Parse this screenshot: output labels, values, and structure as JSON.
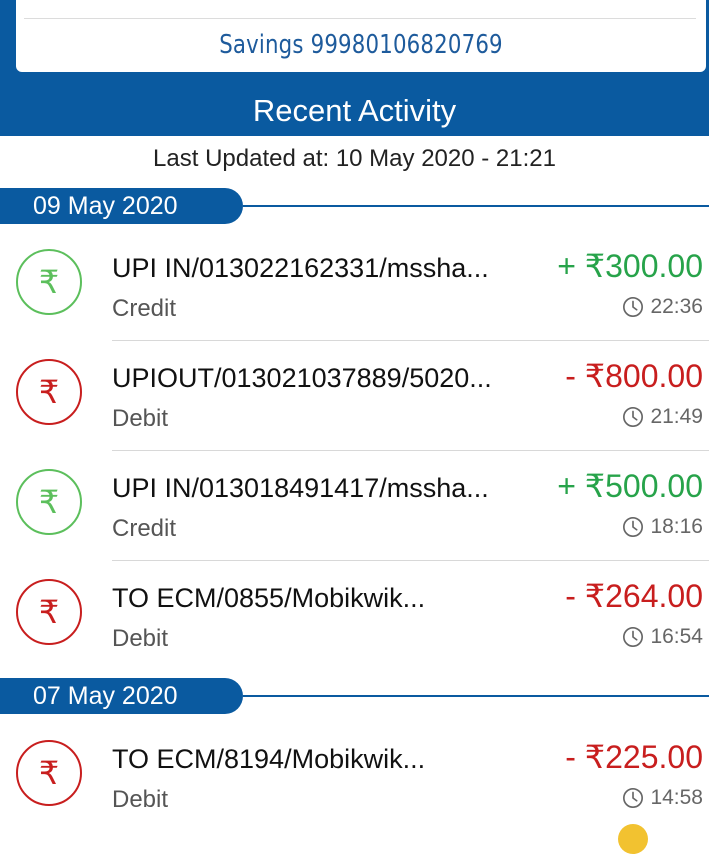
{
  "account": {
    "label": "Savings 99980106820769"
  },
  "section_title": "Recent Activity",
  "last_updated": "Last Updated at: 10 May 2020 - 21:21",
  "groups": [
    {
      "date": "09 May 2020",
      "transactions": [
        {
          "description": "UPI IN/013022162331/mssha...",
          "type": "Credit",
          "amount": "+ ₹300.00",
          "time": "22:36",
          "icon": "rupee-icon"
        },
        {
          "description": "UPIOUT/013021037889/5020...",
          "type": "Debit",
          "amount": "- ₹800.00",
          "time": "21:49",
          "icon": "rupee-icon"
        },
        {
          "description": "UPI IN/013018491417/mssha...",
          "type": "Credit",
          "amount": "+ ₹500.00",
          "time": "18:16",
          "icon": "rupee-icon"
        },
        {
          "description": "TO ECM/0855/Mobikwik...",
          "type": "Debit",
          "amount": "- ₹264.00",
          "time": "16:54",
          "icon": "rupee-icon"
        }
      ]
    },
    {
      "date": "07 May 2020",
      "transactions": [
        {
          "description": "TO ECM/8194/Mobikwik...",
          "type": "Debit",
          "amount": "- ₹225.00",
          "time": "14:58",
          "icon": "rupee-icon"
        }
      ]
    }
  ],
  "colors": {
    "brand": "#0a5aa0",
    "credit": "#27a34a",
    "debit": "#c81e1e"
  },
  "icons": {
    "rupee": "₹",
    "clock": "clock-icon"
  }
}
